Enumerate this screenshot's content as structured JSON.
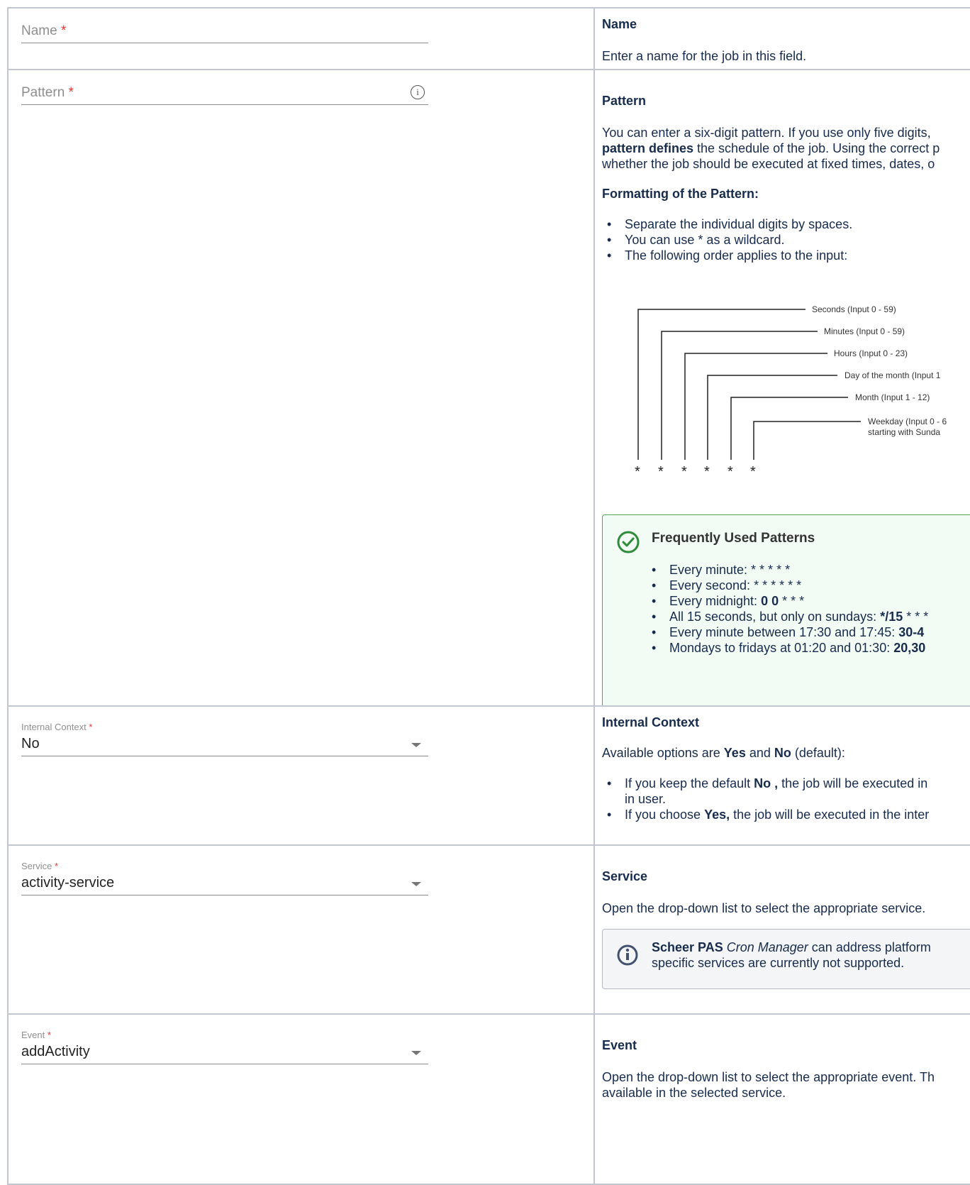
{
  "rows": {
    "name": {
      "field": {
        "label": "Name",
        "required_mark": "*"
      },
      "heading": "Name",
      "text": "Enter a name for the job in this field."
    },
    "pattern": {
      "field": {
        "label": "Pattern",
        "required_mark": "*",
        "info_icon": "info-icon"
      },
      "heading": "Pattern",
      "para_lines": [
        "You can enter a six-digit pattern. If you use only five digits,",
        "pattern defines the schedule of the job. Using the correct p",
        "whether the job should be executed at fixed times, dates, o"
      ],
      "para_line2_bold": "pattern defines",
      "para_line2_rest": " the schedule of the job. Using the correct p",
      "formatting_heading": "Formatting of the Pattern:",
      "bullets": [
        "Separate the individual digits by spaces.",
        "You can use * as a wildcard.",
        "The following order applies to the input:"
      ],
      "diagram": {
        "labels": [
          "Seconds (Input 0 - 59)",
          "Minutes (Input 0 - 59)",
          "Hours (Input 0 - 23)",
          "Day of the month (Input 1",
          "Month (Input 1 - 12)",
          "Weekday (Input 0 - 6",
          "starting with Sunda"
        ],
        "star": "*"
      },
      "frequent": {
        "title": "Frequently Used Patterns",
        "icon": "check-circle-icon",
        "items": [
          {
            "text": "Every minute: ",
            "bold": "",
            "rest": "* * * * *"
          },
          {
            "text": "Every second: ",
            "bold": "",
            "rest": "* * * * * *"
          },
          {
            "text": "Every midnight: ",
            "bold": "0 0",
            "rest": " * * *"
          },
          {
            "text": "All 15 seconds, but only on sundays: ",
            "bold": "*/15",
            "rest": " * * *"
          },
          {
            "text": "Every minute between 17:30 and 17:45: ",
            "bold": "30-4",
            "rest": ""
          },
          {
            "text": "Mondays to fridays at 01:20 and 01:30: ",
            "bold": "20,30",
            "rest": ""
          }
        ]
      }
    },
    "internal_context": {
      "field": {
        "label": "Internal Context",
        "required_mark": "*",
        "value": "No"
      },
      "heading": "Internal Context",
      "avail_pre": "Available options are ",
      "avail_yes": "Yes",
      "avail_mid": " and ",
      "avail_no": "No",
      "avail_post": " (default):",
      "bullet1_pre": "If you keep the default ",
      "bullet1_bold": "No ,",
      "bullet1_post": " the job will be executed in",
      "bullet1_line2": "in user.",
      "bullet2_pre": "If you choose ",
      "bullet2_bold": "Yes,",
      "bullet2_post": " the job will be executed in the inter"
    },
    "service": {
      "field": {
        "label": "Service",
        "required_mark": "*",
        "value": "activity-service"
      },
      "heading": "Service",
      "text": "Open the drop-down list to select the appropriate service.",
      "note": {
        "icon": "info-icon",
        "bold": "Scheer PAS",
        "italic": "Cron Manager",
        "rest": " can address platform",
        "line2": "specific services are currently not supported."
      }
    },
    "event": {
      "field": {
        "label": "Event",
        "required_mark": "*",
        "value": "addActivity"
      },
      "heading": "Event",
      "text_line1": "Open the drop-down list to select the appropriate event. Th",
      "text_line2": "available in the selected service."
    }
  },
  "colors": {
    "border": "#c1c7d0",
    "text": "#172b4d",
    "required": "#e53935",
    "success": "#57a55a",
    "success_bg": "#f3fcf4",
    "info_bg": "#f4f5f7"
  }
}
